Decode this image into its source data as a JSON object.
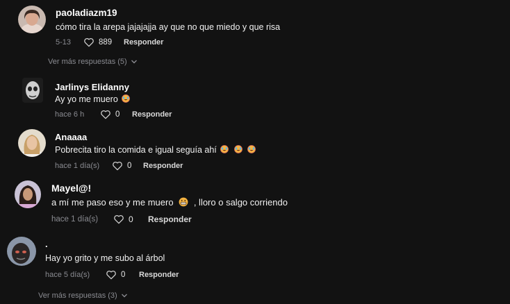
{
  "comments": [
    {
      "username": "paoladiazm19",
      "text": "cómo tira la arepa jajajajja ay que no que miedo y que risa",
      "time": "5-13",
      "likes": "889",
      "reply": "Responder",
      "avatar": "woman-selfie-avatar"
    },
    {
      "username": "Jarlinys Elidanny",
      "text": "Ay yo me muero",
      "time": "hace 6 h",
      "likes": "0",
      "reply": "Responder",
      "avatar": "masked-face-avatar",
      "emoji": "crying-laughing-emoji"
    },
    {
      "username": "Anaaaa",
      "text": "Pobrecita tiro la comida e igual seguía ahí",
      "time": "hace 1 día(s)",
      "likes": "0",
      "reply": "Responder",
      "avatar": "blonde-woman-avatar",
      "emoji": "crying-laughing-emoji"
    },
    {
      "username": "Mayel@!",
      "text": "a mí me paso eso y me muero",
      "text_after": ", lloro o salgo corriendo",
      "time": "hace 1 día(s)",
      "likes": "0",
      "reply": "Responder",
      "avatar": "girl-portrait-avatar",
      "emoji": "grimacing-emoji"
    },
    {
      "username": ".",
      "text": "Hay yo grito y me subo al árbol",
      "time": "hace 5 día(s)",
      "likes": "0",
      "reply": "Responder",
      "avatar": "dark-face-avatar"
    }
  ],
  "view_more": [
    {
      "label": "Ver más respuestas (5)"
    },
    {
      "label": "Ver más respuestas (3)"
    }
  ],
  "colors": {
    "background": "#121212",
    "secondary_text": "#8a8b91",
    "primary_text": "#ffffff"
  }
}
